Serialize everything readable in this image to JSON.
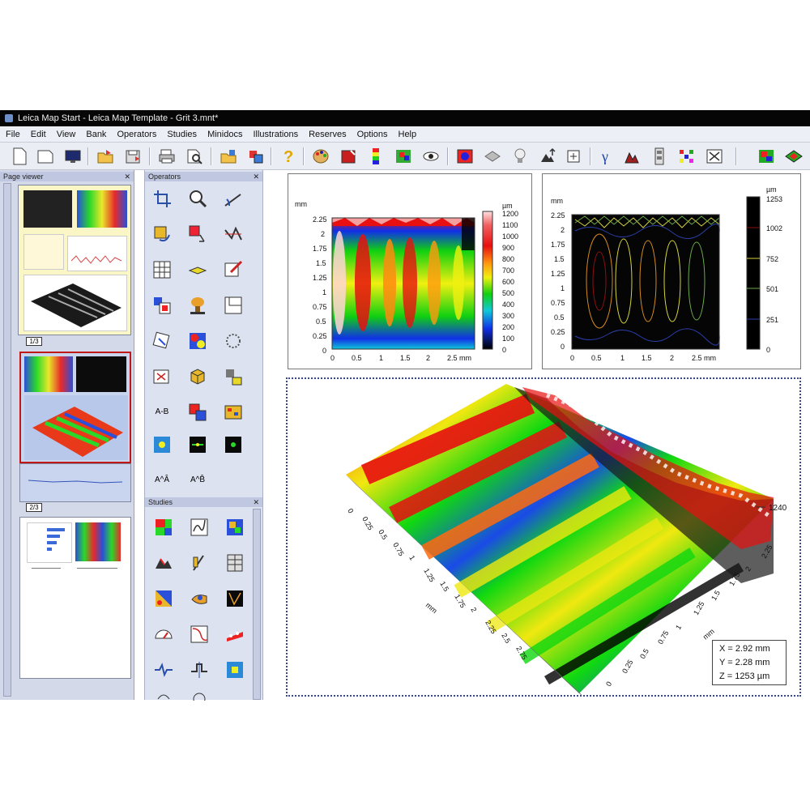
{
  "window": {
    "title": "Leica Map Start - Leica Map Template - Grit 3.mnt*"
  },
  "menu": [
    "File",
    "Edit",
    "View",
    "Bank",
    "Operators",
    "Studies",
    "Minidocs",
    "Illustrations",
    "Reserves",
    "Options",
    "Help"
  ],
  "panels": {
    "page_viewer": "Page viewer",
    "operators": "Operators",
    "studies": "Studies"
  },
  "pages": [
    "1/3",
    "2/3",
    "3/3"
  ],
  "operators": {
    "subtract_label": "A-B",
    "a1_label": "A^Â",
    "a2_label": "A^B̂"
  },
  "plot_color": {
    "y_unit": "mm",
    "x_unit": "mm",
    "z_unit": "µm",
    "y_ticks": [
      "2.25",
      "2",
      "1.75",
      "1.5",
      "1.25",
      "1",
      "0.75",
      "0.5",
      "0.25",
      "0"
    ],
    "x_ticks": [
      "0",
      "0.5",
      "1",
      "1.5",
      "2",
      "2.5 mm"
    ],
    "colorbar_ticks": [
      "1200",
      "1100",
      "1000",
      "900",
      "800",
      "700",
      "600",
      "500",
      "400",
      "300",
      "200",
      "100",
      "0"
    ]
  },
  "plot_contour": {
    "y_unit": "mm",
    "z_unit": "µm",
    "y_ticks": [
      "2.25",
      "2",
      "1.75",
      "1.5",
      "1.25",
      "1",
      "0.75",
      "0.5",
      "0.25",
      "0"
    ],
    "x_ticks": [
      "0",
      "0.5",
      "1",
      "1.5",
      "2",
      "2.5 mm"
    ],
    "colorbar_ticks": [
      "1253",
      "1002",
      "752",
      "501",
      "251",
      "0"
    ],
    "colors": [
      "#8a1010",
      "#d28a1e",
      "#d4d23a",
      "#6aa84a",
      "#2a3fa8"
    ]
  },
  "plot_3d": {
    "left_axis_ticks": [
      "0",
      "0.25",
      "0.5",
      "0.75",
      "1",
      "1.25",
      "1.5",
      "1.75",
      "2",
      "2.25",
      "2.5",
      "2.75"
    ],
    "right_axis_ticks": [
      "0",
      "0.25",
      "0.5",
      "0.75",
      "1",
      "1.25",
      "1.5",
      "1.75",
      "2",
      "2.25"
    ],
    "axis_unit": "mm",
    "z_label": "1240"
  },
  "readout": {
    "x": "X = 2.92 mm",
    "y": "Y = 2.28 mm",
    "z": "Z = 1253 µm"
  }
}
